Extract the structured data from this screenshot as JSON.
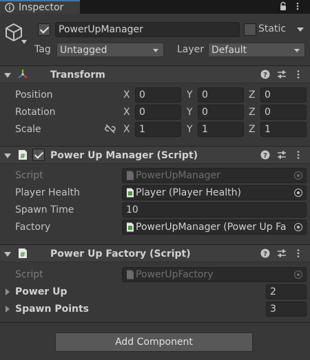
{
  "colors": {
    "background": "#383838",
    "tab_accent": "#3a79bb",
    "field_bg": "#2a2a2a",
    "header_bg": "#3e3e3e",
    "transform_x": "#e0433c",
    "transform_y": "#8ac13b",
    "transform_z": "#3c7fe0",
    "script_icon": "#6fbf60"
  },
  "tab": {
    "title": "Inspector",
    "icon": "info-icon",
    "lock_icon": "lock-icon",
    "menu_icon": "kebab-menu-icon"
  },
  "gameobject": {
    "icon": "cube-icon",
    "active": true,
    "name": "PowerUpManager",
    "static_label": "Static",
    "static_checked": false,
    "tag_label": "Tag",
    "tag_value": "Untagged",
    "layer_label": "Layer",
    "layer_value": "Default"
  },
  "transform": {
    "title": "Transform",
    "icon": "transform-axes-icon",
    "rows": [
      {
        "label": "Position",
        "x": "0",
        "y": "0",
        "z": "0"
      },
      {
        "label": "Rotation",
        "x": "0",
        "y": "0",
        "z": "0"
      },
      {
        "label": "Scale",
        "x": "1",
        "y": "1",
        "z": "1"
      }
    ],
    "axis_x": "X",
    "axis_y": "Y",
    "axis_z": "Z",
    "scale_link_icon": "link-broken-icon"
  },
  "power_up_manager": {
    "title": "Power Up Manager (Script)",
    "icon": "csharp-script-icon",
    "enabled": true,
    "fields": {
      "script_label": "Script",
      "script_value": "PowerUpManager",
      "player_health_label": "Player Health",
      "player_health_value": "Player (Player Health)",
      "spawn_time_label": "Spawn Time",
      "spawn_time_value": "10",
      "factory_label": "Factory",
      "factory_value": "PowerUpManager (Power Up Fa"
    }
  },
  "power_up_factory": {
    "title": "Power Up Factory (Script)",
    "icon": "csharp-script-icon",
    "fields": {
      "script_label": "Script",
      "script_value": "PowerUpFactory",
      "power_up_label": "Power Up",
      "power_up_count": "2",
      "spawn_points_label": "Spawn Points",
      "spawn_points_count": "3"
    }
  },
  "header_icons": {
    "help": "help-icon",
    "presets": "presets-icon",
    "menu": "kebab-menu-icon"
  },
  "add_component_label": "Add Component"
}
